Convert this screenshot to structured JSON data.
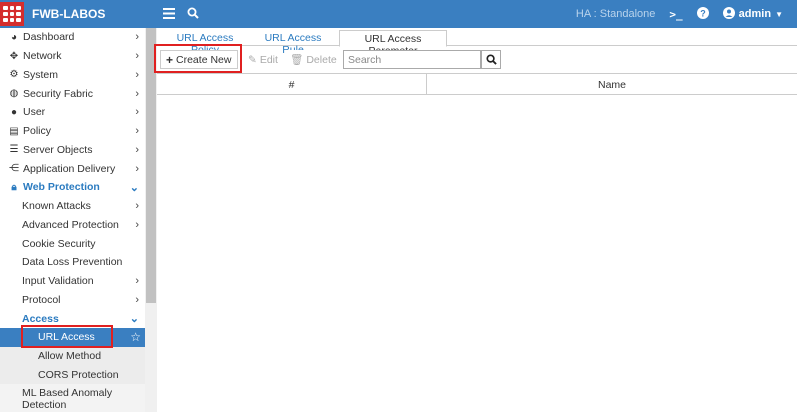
{
  "header": {
    "brand": "FWB-LABOS",
    "ha_label": "HA :",
    "ha_status": "Standalone",
    "user": "admin"
  },
  "icons": {
    "menu": "hamburger-icon",
    "search": "search-icon",
    "cli": "terminal-icon",
    "help": "help-icon",
    "user": "user-icon"
  },
  "sidebar": {
    "items": [
      {
        "label": "Dashboard",
        "icon": "dashboard-icon"
      },
      {
        "label": "Network",
        "icon": "network-icon"
      },
      {
        "label": "System",
        "icon": "gear-icon"
      },
      {
        "label": "Security Fabric",
        "icon": "security-fabric-icon"
      },
      {
        "label": "User",
        "icon": "user-icon"
      },
      {
        "label": "Policy",
        "icon": "policy-icon"
      },
      {
        "label": "Server Objects",
        "icon": "server-objects-icon"
      },
      {
        "label": "Application Delivery",
        "icon": "application-delivery-icon"
      },
      {
        "label": "Web Protection",
        "icon": "lock-icon"
      },
      {
        "label": "Known Attacks"
      },
      {
        "label": "Advanced Protection"
      },
      {
        "label": "Cookie Security"
      },
      {
        "label": "Data Loss Prevention"
      },
      {
        "label": "Input Validation"
      },
      {
        "label": "Protocol"
      },
      {
        "label": "Access"
      },
      {
        "label": "URL Access"
      },
      {
        "label": "Allow Method"
      },
      {
        "label": "CORS Protection"
      },
      {
        "label": "ML Based Anomaly Detection"
      }
    ]
  },
  "tabs": [
    {
      "label": "URL Access Policy"
    },
    {
      "label": "URL Access Rule"
    },
    {
      "label": "URL Access Parameter"
    }
  ],
  "toolbar": {
    "create_new": "Create New",
    "edit": "Edit",
    "delete": "Delete",
    "search_placeholder": "Search"
  },
  "table": {
    "columns": [
      "#",
      "Name"
    ]
  },
  "colors": {
    "topbar": "#3a7fc1",
    "accent": "#2b7bc0",
    "logo": "#d42e2e",
    "highlight": "#e02020"
  }
}
